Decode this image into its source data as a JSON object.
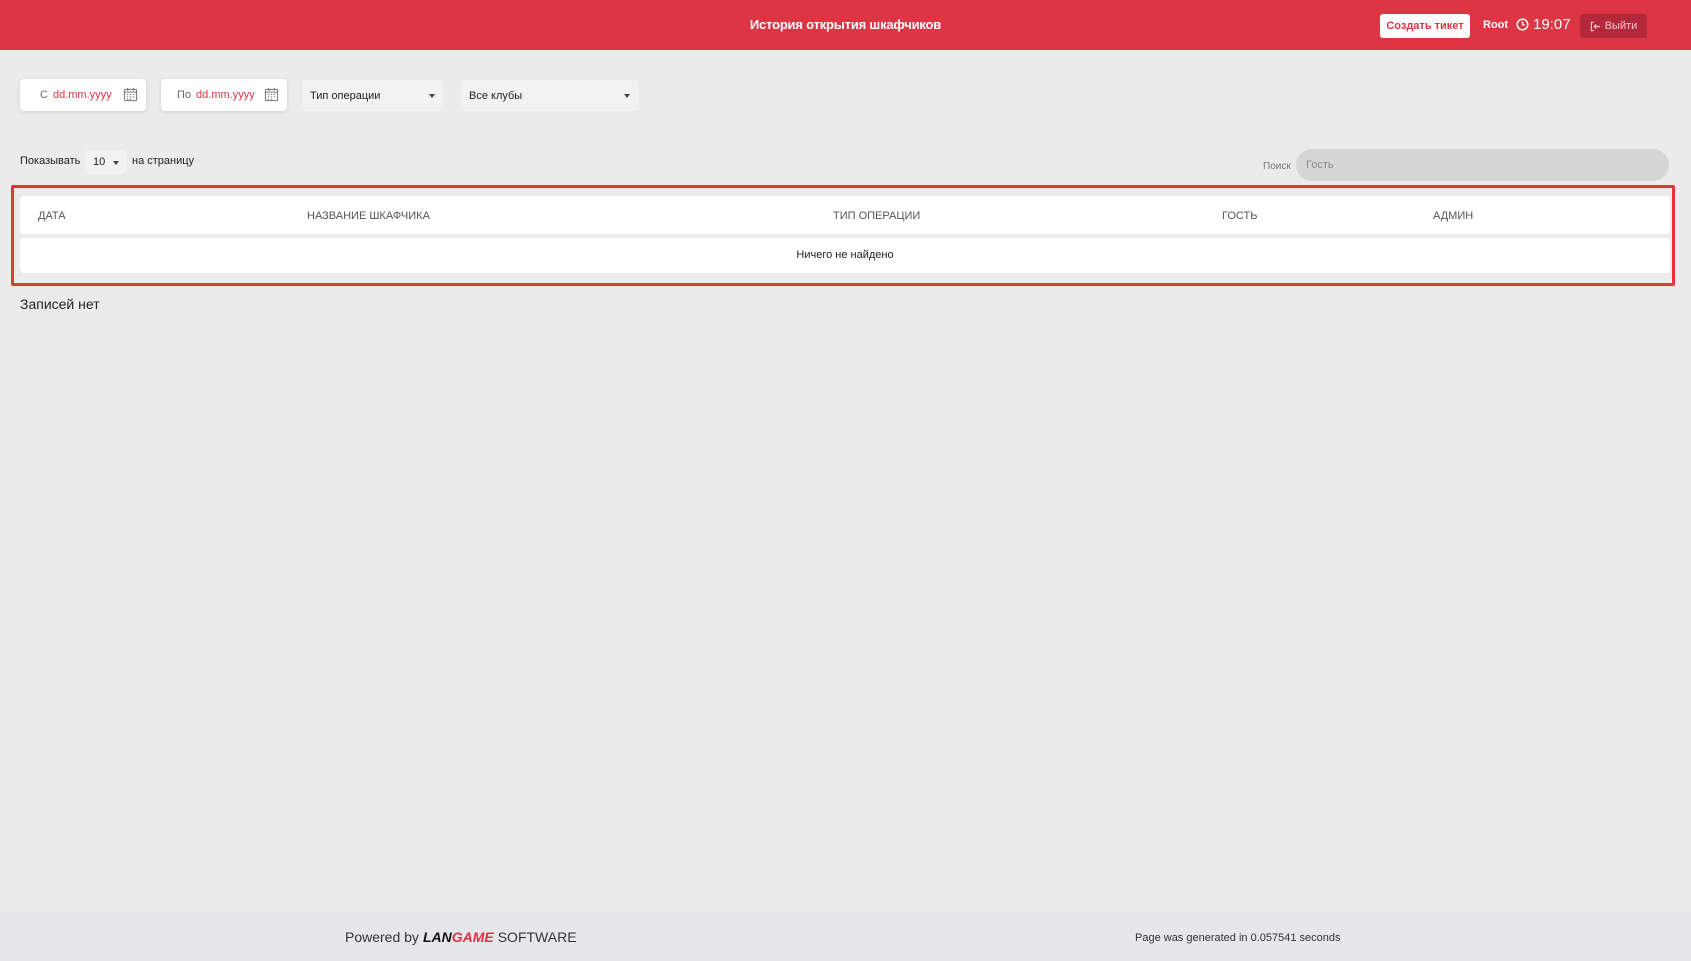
{
  "header": {
    "title": "История открытия шкафчиков",
    "create_ticket_label": "Создать тикет",
    "user": "Root",
    "time": "19:07",
    "logout_label": "Выйти",
    "accent_color": "#dd3544"
  },
  "filters": {
    "from_label": "С",
    "from_value": "dd.mm.yyyy",
    "to_label": "По",
    "to_value": "dd.mm.yyyy",
    "operation_type": "Тип операции",
    "club": "Все клубы"
  },
  "pagination": {
    "show_label": "Показывать",
    "page_size": "10",
    "per_page_label": "на страницу"
  },
  "search": {
    "label": "Поиск",
    "placeholder": "Гость"
  },
  "table": {
    "columns": [
      "ДАТА",
      "НАЗВАНИЕ ШКАФЧИКА",
      "ТИП ОПЕРАЦИИ",
      "ГОСТЬ",
      "АДМИН"
    ],
    "empty_message": "Ничего не найдено"
  },
  "status": {
    "no_records": "Записей нет"
  },
  "footer": {
    "powered_by": "Powered by",
    "brand_lan": "LAN",
    "brand_game": "GAME",
    "brand_software": "SOFTWARE",
    "generated": "Page was generated in 0.057541 seconds"
  }
}
